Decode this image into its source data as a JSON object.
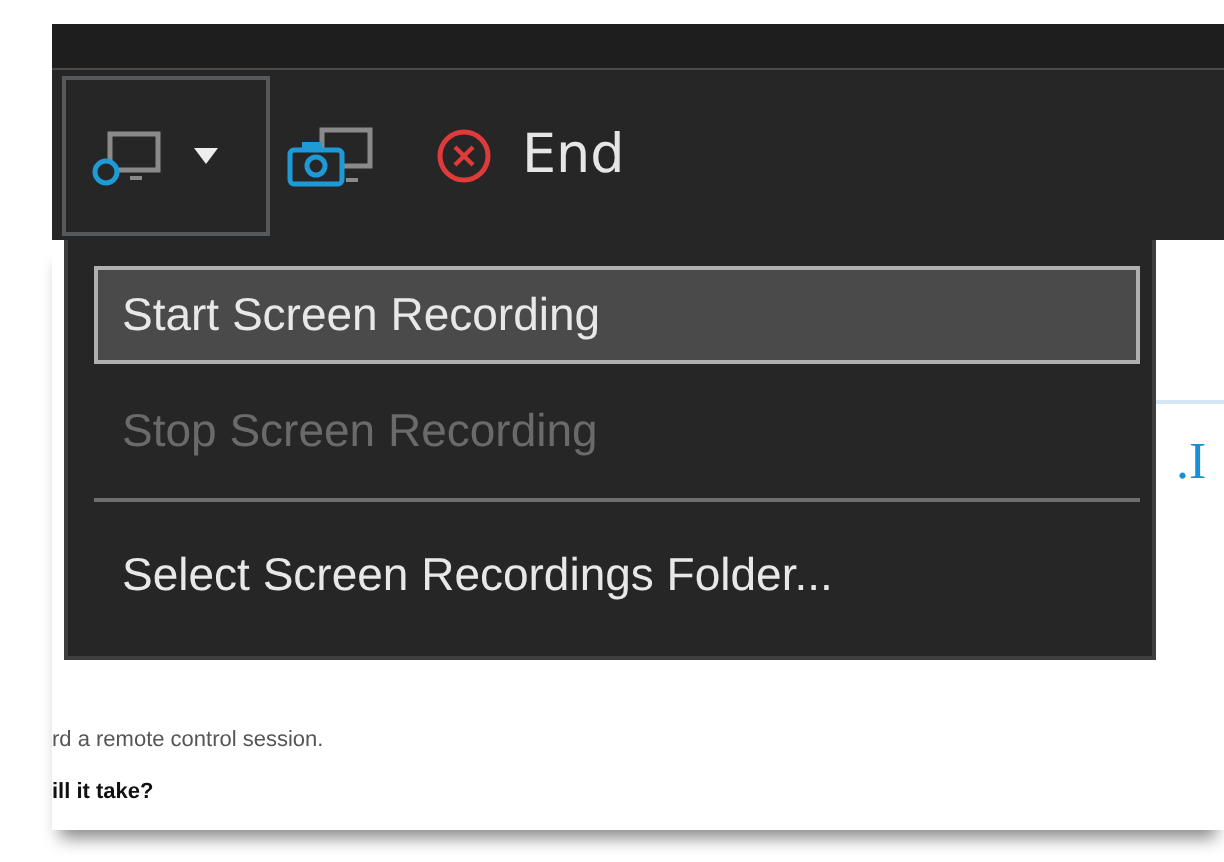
{
  "toolbar": {
    "buttons": [
      {
        "kind": "record",
        "expanded": true
      },
      {
        "kind": "snapshot"
      },
      {
        "kind": "end",
        "label": "End"
      }
    ]
  },
  "menu": {
    "items": [
      {
        "kind": "item",
        "label": "Start Screen Recording",
        "selected": true,
        "disabled": false
      },
      {
        "kind": "item",
        "label": "Stop Screen Recording",
        "selected": false,
        "disabled": true
      },
      {
        "kind": "separator"
      },
      {
        "kind": "item",
        "label": "Select Screen Recordings Folder...",
        "selected": false,
        "disabled": false
      }
    ]
  },
  "page": {
    "side_text": ".I",
    "texts": [
      {
        "kind": "body",
        "text": "rd a remote control session."
      },
      {
        "kind": "heading",
        "text": "ill it take?"
      }
    ]
  }
}
